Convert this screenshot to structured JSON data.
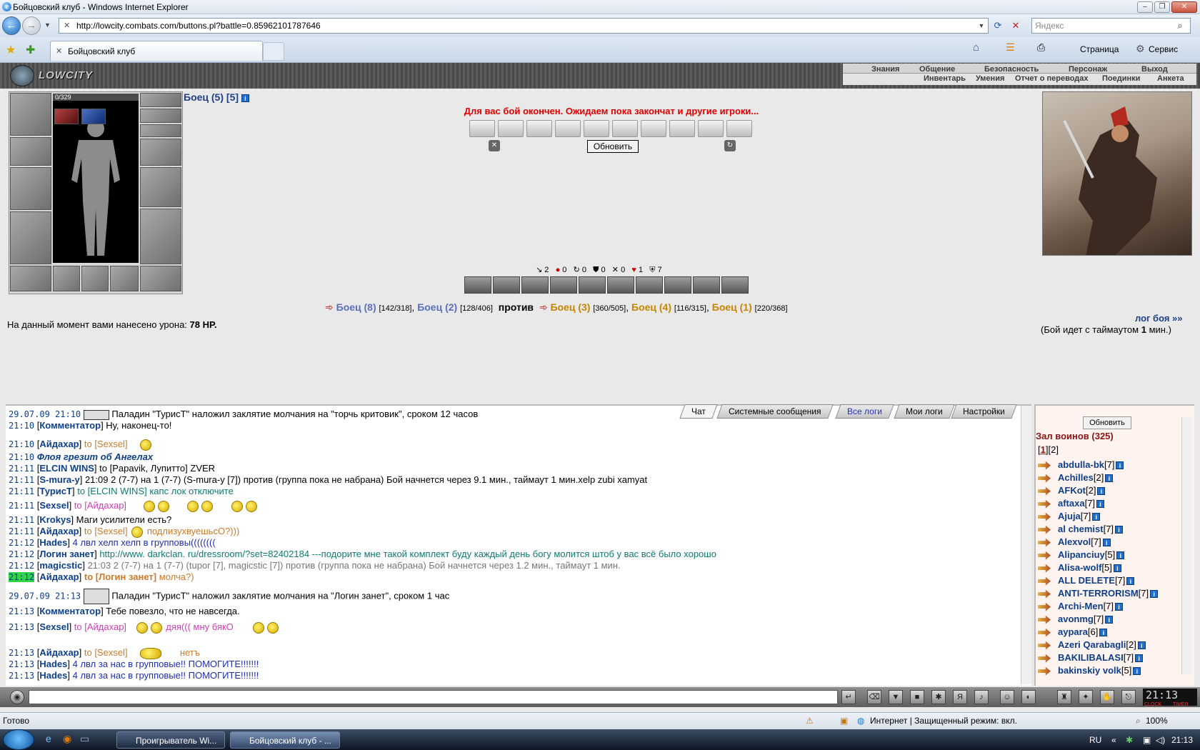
{
  "window": {
    "title": "Бойцовский клуб - Windows Internet Explorer",
    "address": "http://lowcity.combats.com/buttons.pl?battle=0.85962101787646",
    "search_placeholder": "Яндекс",
    "tab_title": "Бойцовский клуб",
    "toolbar": {
      "page": "Страница",
      "service": "Сервис"
    }
  },
  "game_header": {
    "logo": "LOWCITY",
    "menu_top": [
      "Знания",
      "Общение",
      "Безопасность",
      "Персонаж",
      "Выход"
    ],
    "menu_bottom": [
      "Инвентарь",
      "Умения",
      "Отчет о переводах",
      "Поединки",
      "Анкета"
    ]
  },
  "player": {
    "name": "Боец (5)",
    "level": "[5]",
    "hp": "0/329",
    "info_icon": "i"
  },
  "battle": {
    "message": "Для вас бой окончен. Ожидаем пока закончат и другие игроки...",
    "refresh_label": "Обновить",
    "stats": [
      "2",
      "0",
      "0",
      "0",
      "0",
      "1",
      "7"
    ],
    "team1": [
      {
        "name": "Боец (8)",
        "hp": "[142/318]"
      },
      {
        "name": "Боец (2)",
        "hp": "[128/406]"
      }
    ],
    "versus": "против",
    "team2": [
      {
        "name": "Боец (3)",
        "hp": "[360/505]"
      },
      {
        "name": "Боец (4)",
        "hp": "[116/315]"
      },
      {
        "name": "Боец (1)",
        "hp": "[220/368]"
      }
    ],
    "damage_label": "На данный момент вами нанесено урона:",
    "damage_value": "78 HP.",
    "log_link": "лог боя »»",
    "timeout_pre": "(Бой идет с таймаутом",
    "timeout_val": "1",
    "timeout_post": "мин.)"
  },
  "chat": {
    "tabs": [
      "Чат",
      "Системные сообщения",
      "Все логи",
      "Мои логи",
      "Настройки"
    ],
    "lines": {
      "l1_time": "29.07.09 21:10",
      "l1_text": "Паладин \"ТурисТ\" наложил заклятие молчания на \"торчь критовик\", сроком 12 часов",
      "l2_time": "21:10",
      "l2_nick": "Комментатор",
      "l2_text": "Ну, наконец-то!",
      "l3_time": "21:10",
      "l3_nick": "Айдахар",
      "l3_to": "to [Sexsel]",
      "l4_time": "21:10",
      "l4_text": "Флоя грезит об Ангелах",
      "l5_time": "21:11",
      "l5_nick": "ELCIN WINS",
      "l5_text": "to [Papavik, Лупитто] ZVER",
      "l6_time": "21:11",
      "l6_nick": "S-mura-y",
      "l6_text": "21:09 2 (7-7) на 1 (7-7) (S-mura-y [7]) против (группа пока не набрана) Бой начнется через 9.1 мин., таймаут 1 мин.xelp zubi xamyat",
      "l7_time": "21:11",
      "l7_nick": "ТурисТ",
      "l7_text": "to [ELCIN WINS] капс лок отключите",
      "l8_time": "21:11",
      "l8_nick": "Sexsel",
      "l8_to": "to [Айдахар]",
      "l9_time": "21:11",
      "l9_nick": "Krokys",
      "l9_text": "Маги усилители есть?",
      "l10_time": "21:11",
      "l10_nick": "Айдахар",
      "l10_to": "to [Sexsel]",
      "l10_text": "подлизуxвуешьсO?)))",
      "l11_time": "21:12",
      "l11_nick": "Hades",
      "l11_text": "4 лвл хелп хелп в групповы((((((((",
      "l12_time": "21:12",
      "l12_nick": "Логин занет",
      "l12_text": "http://www. darkclan. ru/dressroom/?set=82402184 ---подорите мне такой комплект буду каждый день богу молится штоб у вас всё было хорошо",
      "l13_time": "21:12",
      "l13_nick": "magicstic",
      "l13_text": "21:03 2 (7-7) на 1 (7-7) (tupor [7], magicstic [7]) против (группа пока не набрана) Бой начнется через 1.2 мин., таймаут 1 мин.",
      "l14_time": "21:12",
      "l14_nick": "Айдахар",
      "l14_to": "to [Логин занет]",
      "l14_text": "молча?)",
      "l15_time": "29.07.09 21:13",
      "l15_text": "Паладин \"ТурисТ\" наложил заклятие молчания на \"Логин занет\", сроком 1 час",
      "l16_time": "21:13",
      "l16_nick": "Комментатор",
      "l16_text": "Тебе повезло, что не навсегда.",
      "l17_time": "21:13",
      "l17_nick": "Sexsel",
      "l17_to": "to [Айдахар]",
      "l17_text": "дяя((( мну бякО",
      "l18_time": "21:13",
      "l18_nick": "Айдахар",
      "l18_to": "to [Sexsel]",
      "l18_text": "нетъ",
      "l19_time": "21:13",
      "l19_nick": "Hades",
      "l19_text": "4 лвл за нас в групповые!! ПОМОГИТЕ!!!!!!!",
      "l20_time": "21:13",
      "l20_nick": "Hades",
      "l20_text": "4 лвл за нас в групповые!! ПОМОГИТЕ!!!!!!!"
    }
  },
  "warriors": {
    "refresh_label": "Обновить",
    "title": "Зал воинов (325)",
    "page1": "1",
    "page2": "2",
    "list": [
      {
        "name": "abdulla-bk",
        "level": "[7]"
      },
      {
        "name": "Achilles",
        "level": "[2]"
      },
      {
        "name": "AFKot",
        "level": "[2]"
      },
      {
        "name": "aftaxa",
        "level": "[7]"
      },
      {
        "name": "Ajuja",
        "level": "[7]"
      },
      {
        "name": "al chemist",
        "level": "[7]"
      },
      {
        "name": "Alexvol",
        "level": "[7]"
      },
      {
        "name": "Alipanciuy",
        "level": "[5]"
      },
      {
        "name": "Alisa-wolf",
        "level": "[5]"
      },
      {
        "name": "ALL DELETE",
        "level": "[7]"
      },
      {
        "name": "ANTI-TERRORISM",
        "level": "[7]"
      },
      {
        "name": "Archi-Men",
        "level": "[7]"
      },
      {
        "name": "avonmg",
        "level": "[7]"
      },
      {
        "name": "aypara",
        "level": "[6]"
      },
      {
        "name": "Azeri Qarabagli",
        "level": "[2]"
      },
      {
        "name": "BAKILIBALASI",
        "level": "[7]"
      },
      {
        "name": "bakinskiy volk",
        "level": "[5]"
      }
    ]
  },
  "clock": "21:13",
  "clock_labels": {
    "clock": "CLOCK",
    "timer": "TIMER"
  },
  "statusbar": {
    "left": "Готово",
    "zone": "Интернет | Защищенный режим: вкл.",
    "zoom": "100%"
  },
  "taskbar": {
    "items": [
      "Проигрыватель Wi...",
      "Бойцовский клуб - ..."
    ],
    "lang": "RU",
    "time": "21:13"
  }
}
